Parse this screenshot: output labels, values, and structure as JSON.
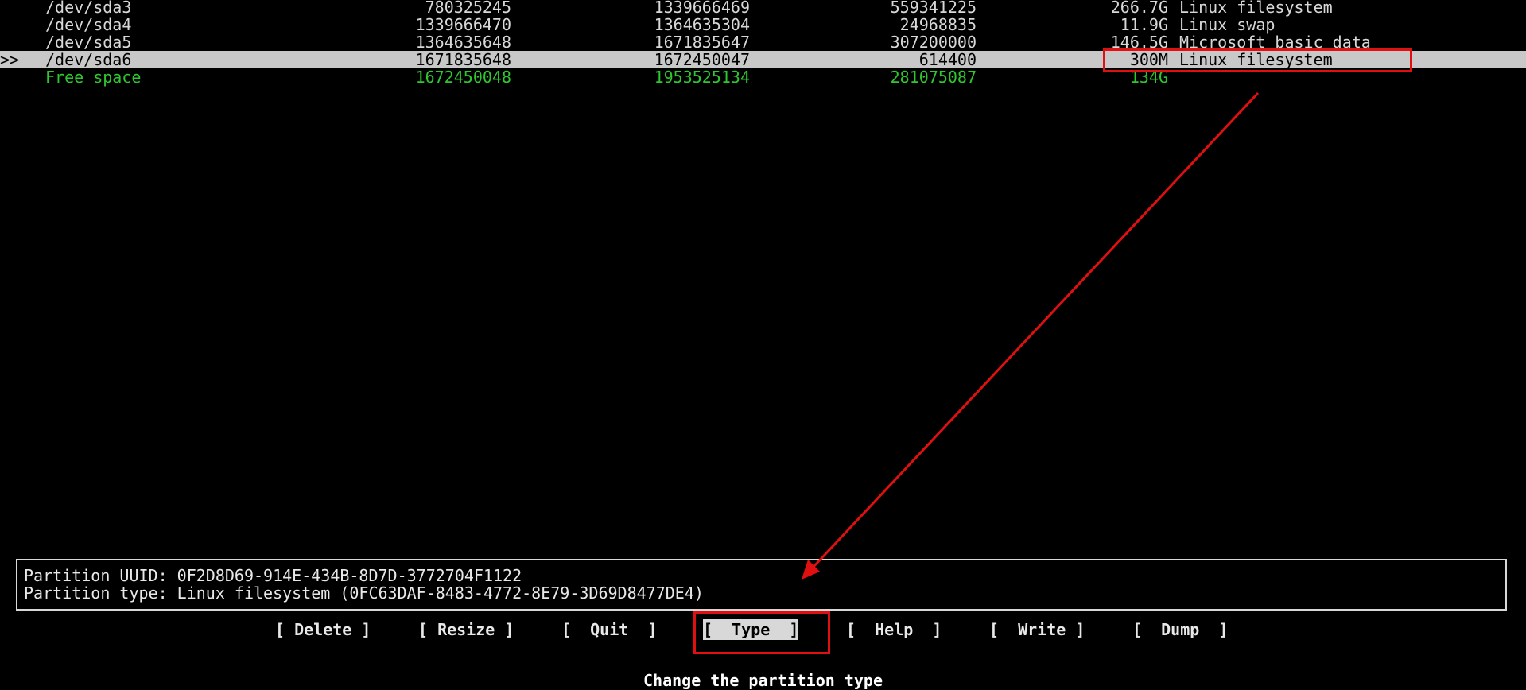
{
  "partition_table": {
    "rows": [
      {
        "pointer": "",
        "device": "/dev/sda3",
        "start": "780325245",
        "end": "1339666469",
        "sectors": "559341225",
        "size": "266.7G",
        "type": "Linux filesystem",
        "selected": false,
        "free": false
      },
      {
        "pointer": "",
        "device": "/dev/sda4",
        "start": "1339666470",
        "end": "1364635304",
        "sectors": "24968835",
        "size": "11.9G",
        "type": "Linux swap",
        "selected": false,
        "free": false
      },
      {
        "pointer": "",
        "device": "/dev/sda5",
        "start": "1364635648",
        "end": "1671835647",
        "sectors": "307200000",
        "size": "146.5G",
        "type": "Microsoft basic data",
        "selected": false,
        "free": false
      },
      {
        "pointer": ">>",
        "device": "/dev/sda6",
        "start": "1671835648",
        "end": "1672450047",
        "sectors": "614400",
        "size": "300M",
        "type": "Linux filesystem",
        "selected": true,
        "free": false
      },
      {
        "pointer": "",
        "device": "Free space",
        "start": "1672450048",
        "end": "1953525134",
        "sectors": "281075087",
        "size": "134G",
        "type": "",
        "selected": false,
        "free": true
      }
    ]
  },
  "info": {
    "uuid_line": "Partition UUID: 0F2D8D69-914E-434B-8D7D-3772704F1122",
    "type_line": "Partition type: Linux filesystem (0FC63DAF-8483-4772-8E79-3D69D8477DE4)"
  },
  "menu": {
    "delete": "[ Delete ]",
    "resize": "[ Resize ]",
    "quit": "[  Quit  ]",
    "type": "[  Type  ]",
    "help": "[  Help  ]",
    "write": "[  Write ]",
    "dump": "[  Dump  ]",
    "active": "type"
  },
  "hint": "Change the partition type",
  "colors": {
    "background": "#000000",
    "text": "#d8d8d8",
    "selected_bg": "#c8c8c8",
    "free_space": "#2ec82e",
    "annotation": "#e01010"
  }
}
